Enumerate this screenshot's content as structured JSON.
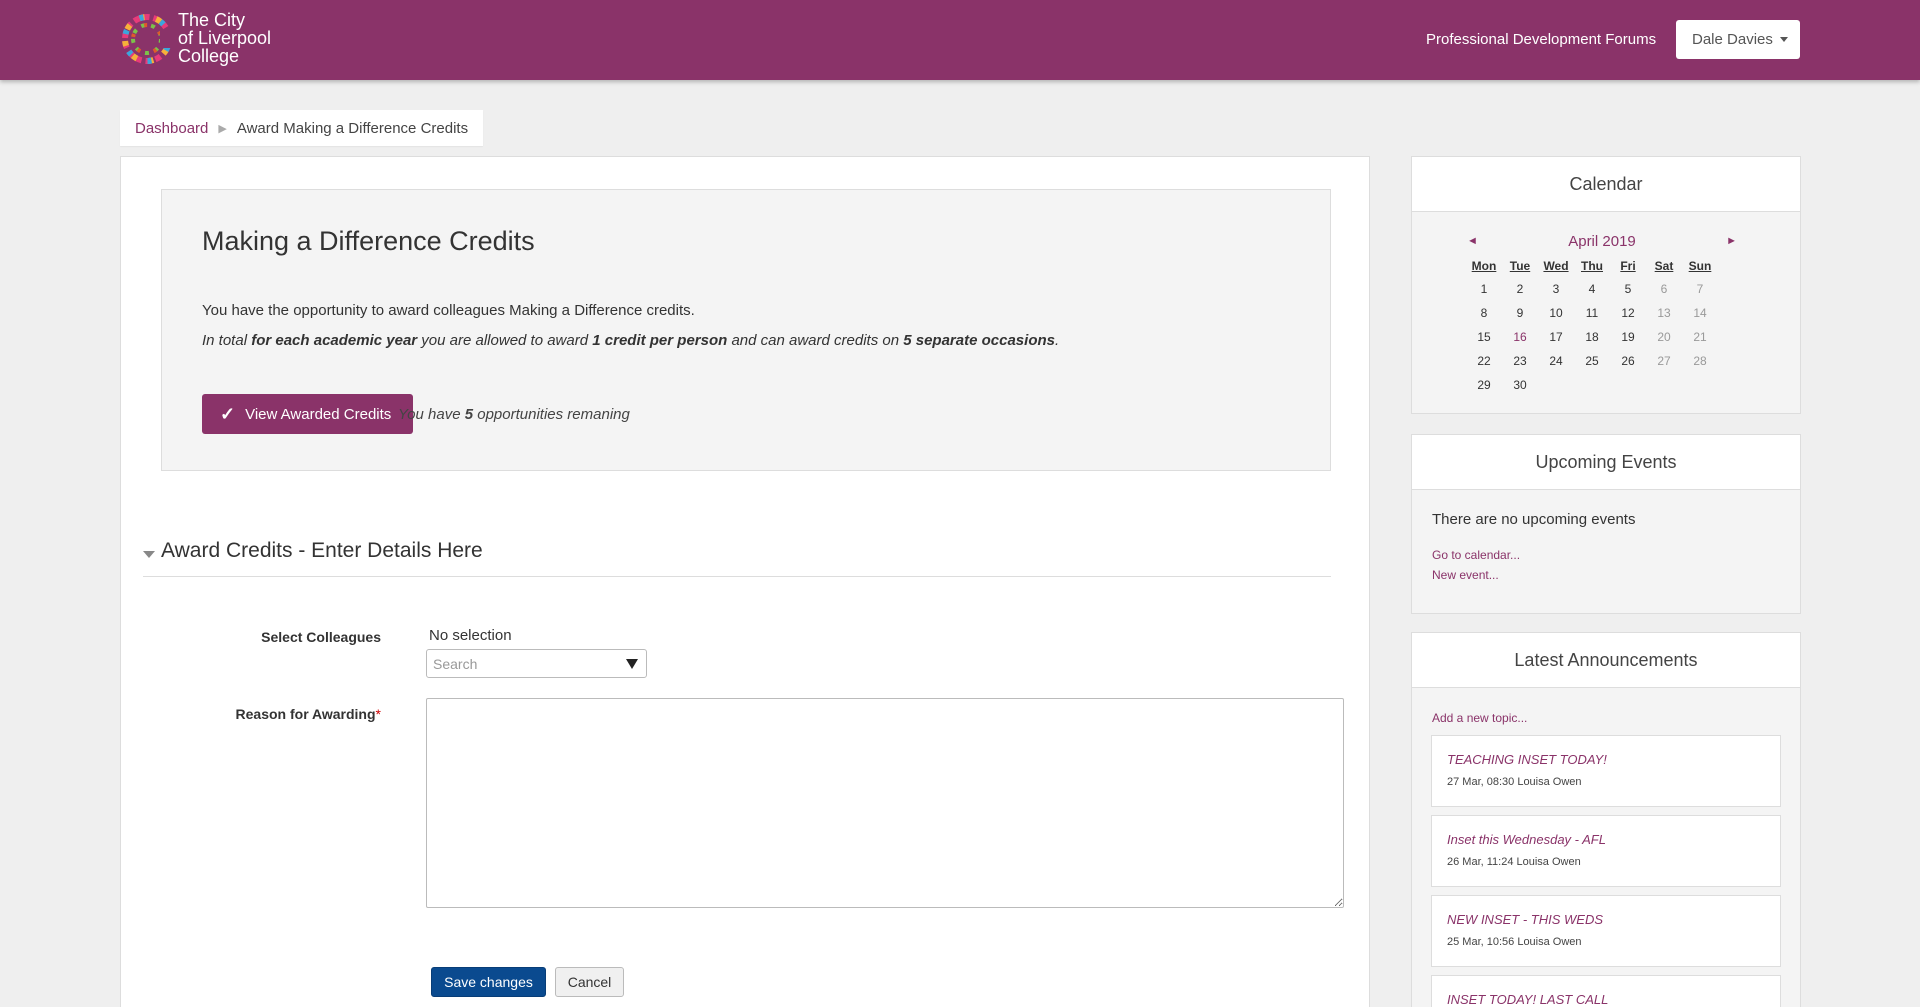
{
  "header": {
    "brand_lines": [
      "The City",
      "of Liverpool",
      "College"
    ],
    "nav_link": "Professional Development Forums",
    "user_name": "Dale Davies",
    "bar_color": "#8a3369"
  },
  "breadcrumb": {
    "home": "Dashboard",
    "current": "Award Making a Difference Credits"
  },
  "intro": {
    "title": "Making a Difference Credits",
    "line1": "You have the opportunity to award colleagues Making a Difference credits.",
    "line2_a": "In total ",
    "line2_b": "for each academic year",
    "line2_c": " you are allowed to award ",
    "line2_d": "1 credit per person",
    "line2_e": " and can award credits on ",
    "line2_f": "5 separate occasions",
    "line2_g": ".",
    "view_button": "View Awarded Credits",
    "remaining_a": "You have ",
    "remaining_count": "5",
    "remaining_b": " opportunities remaning"
  },
  "form": {
    "section_title": "Award Credits - Enter Details Here",
    "colleagues_label": "Select Colleagues",
    "no_selection": "No selection",
    "search_placeholder": "Search",
    "reason_label": "Reason for Awarding",
    "required_mark": "*",
    "save": "Save changes",
    "cancel": "Cancel"
  },
  "calendar": {
    "title": "Calendar",
    "prev": "◄",
    "next": "►",
    "month": "April 2019",
    "days": [
      "Mon",
      "Tue",
      "Wed",
      "Thu",
      "Fri",
      "Sat",
      "Sun"
    ],
    "weeks": [
      [
        "1",
        "2",
        "3",
        "4",
        "5",
        "6",
        "7"
      ],
      [
        "8",
        "9",
        "10",
        "11",
        "12",
        "13",
        "14"
      ],
      [
        "15",
        "16",
        "17",
        "18",
        "19",
        "20",
        "21"
      ],
      [
        "22",
        "23",
        "24",
        "25",
        "26",
        "27",
        "28"
      ],
      [
        "29",
        "30",
        "",
        "",
        "",
        "",
        ""
      ]
    ],
    "today": "16"
  },
  "events": {
    "title": "Upcoming Events",
    "none_text": "There are no upcoming events",
    "go_link": "Go to calendar...",
    "new_link": "New event..."
  },
  "announcements": {
    "title": "Latest Announcements",
    "add_link": "Add a new topic...",
    "posts": [
      {
        "title": "TEACHING INSET TODAY!",
        "meta": "27 Mar, 08:30 Louisa Owen"
      },
      {
        "title": "Inset this Wednesday - AFL",
        "meta": "26 Mar, 11:24 Louisa Owen"
      },
      {
        "title": "NEW INSET - THIS WEDS",
        "meta": "25 Mar, 10:56 Louisa Owen"
      },
      {
        "title": "INSET TODAY! LAST CALL",
        "meta": ""
      }
    ]
  }
}
